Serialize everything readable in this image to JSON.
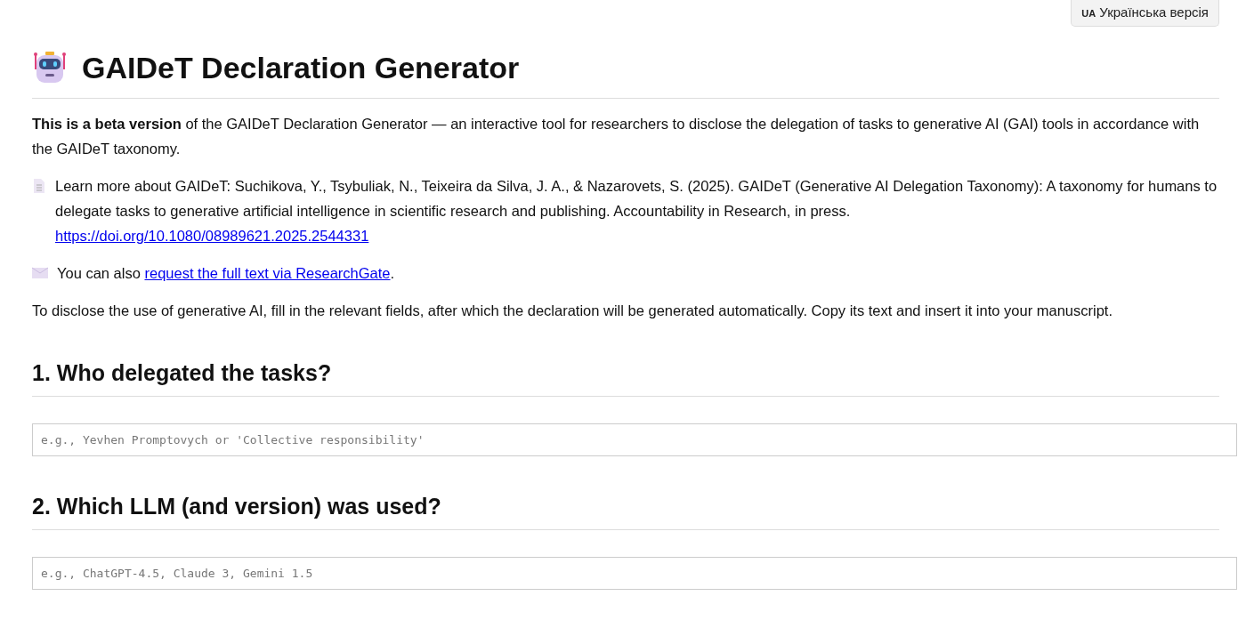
{
  "language_button": {
    "flag": "UA",
    "label": "Українська версія"
  },
  "title": "GAIDeT Declaration Generator",
  "intro": "**This is a beta version** of the GAIDeT Declaration Generator — an interactive tool for researchers to disclose the delegation of tasks to generative AI (GAI) tools in accordance with the GAIDeT taxonomy.",
  "reference": {
    "text": "Learn more about GAIDeT: Suchikova, Y., Tsybuliak, N., Teixeira da Silva, J. A., & Nazarovets, S. (2025). GAIDeT (Generative AI Delegation Taxonomy): A taxonomy for humans to delegate tasks to generative artificial intelligence in scientific research and publishing. Accountability in Research, in press.",
    "link": "https://doi.org/10.1080/08989621.2025.2544331"
  },
  "request": {
    "before": "You can also",
    "link": "request the full text via ResearchGate",
    "after": "."
  },
  "instructions": "To disclose the use of generative AI, fill in the relevant fields, after which the declaration will be generated automatically. Copy its text and insert it into your manuscript.",
  "sections": [
    {
      "heading": "1. Who delegated the tasks?",
      "placeholder": "e.g., Yevhen Promptovych or 'Collective responsibility'"
    },
    {
      "heading": "2. Which LLM (and version) was used?",
      "placeholder": "e.g., ChatGPT-4.5, Claude 3, Gemini 1.5"
    }
  ]
}
